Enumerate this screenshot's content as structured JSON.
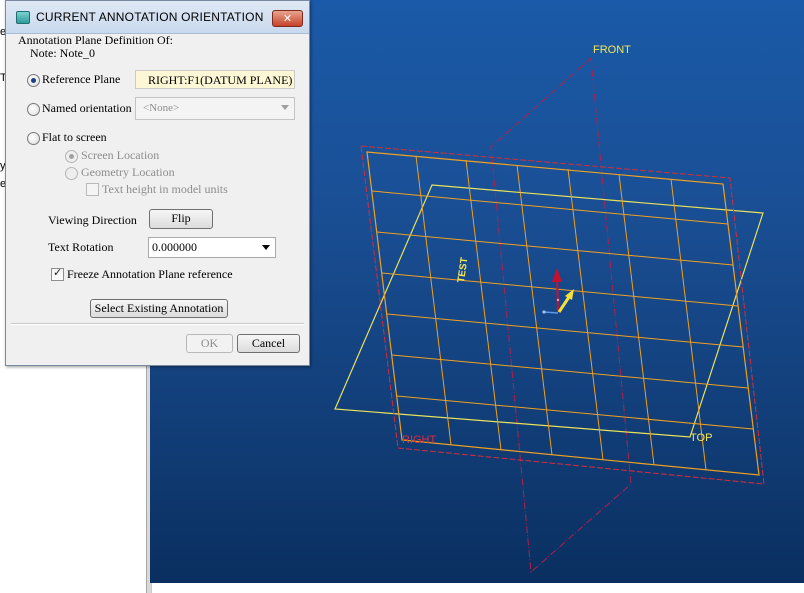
{
  "background_app": {
    "partial_letters": [
      "e",
      "T",
      "y",
      "er"
    ]
  },
  "viewport": {
    "labels": {
      "front": "FRONT",
      "right": "RIGHT",
      "top": "TOP",
      "note_text": "TEST"
    },
    "colors": {
      "front_plane": "#b3204a",
      "right_plane": "#d22e3c",
      "top_plane": "#e8e25a",
      "grid": "#f0a020",
      "label_yellow": "#f4e75a",
      "label_red": "#e02b3a"
    }
  },
  "dialog": {
    "title": "CURRENT ANNOTATION ORIENTATION",
    "close_glyph": "✕",
    "definition_header": "Annotation Plane Definition Of:",
    "note_line": "Note: Note_0",
    "reference_plane": {
      "label": "Reference Plane",
      "value": "RIGHT:F1(DATUM PLANE)",
      "selected": true
    },
    "named_orientation": {
      "label": "Named orientation",
      "value": "<None>"
    },
    "flat_to_screen": {
      "label": "Flat to screen",
      "screen_location": "Screen Location",
      "geometry_location": "Geometry Location",
      "text_height": "Text height in model units"
    },
    "viewing_direction": {
      "label": "Viewing Direction",
      "button": "Flip"
    },
    "text_rotation": {
      "label": "Text Rotation",
      "value": "0.000000"
    },
    "freeze": {
      "label": "Freeze Annotation Plane reference",
      "checked": true
    },
    "select_existing": "Select Existing Annotation",
    "ok": "OK",
    "cancel": "Cancel"
  }
}
